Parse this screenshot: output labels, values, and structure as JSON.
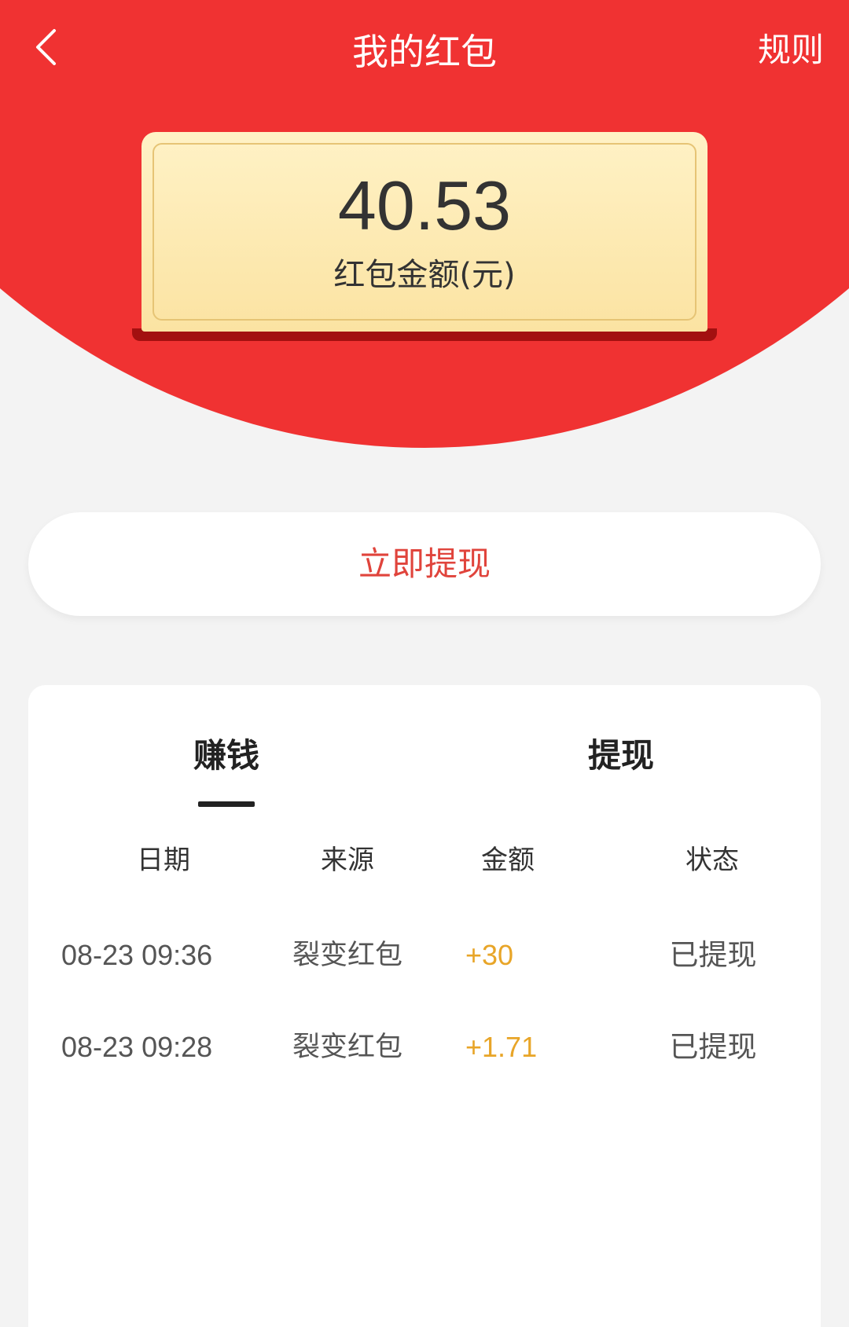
{
  "header": {
    "title": "我的红包",
    "rules_label": "规则"
  },
  "balance": {
    "amount": "40.53",
    "label": "红包金额(元)"
  },
  "withdraw_button_label": "立即提现",
  "tabs": [
    {
      "label": "赚钱",
      "active": true
    },
    {
      "label": "提现",
      "active": false
    }
  ],
  "table": {
    "columns": [
      "日期",
      "来源",
      "金额",
      "状态"
    ],
    "rows": [
      {
        "date": "08-23 09:36",
        "source": "裂变红包",
        "amount": "+30",
        "status": "已提现"
      },
      {
        "date": "08-23 09:28",
        "source": "裂变红包",
        "amount": "+1.71",
        "status": "已提现"
      }
    ]
  },
  "colors": {
    "header_red": "#f03232",
    "card_gold": "#fbe3a2",
    "button_text_red": "#e0443c",
    "amount_gold": "#e8a528",
    "background": "#f3f3f3"
  },
  "icons": {
    "back": "chevron-left-icon"
  }
}
